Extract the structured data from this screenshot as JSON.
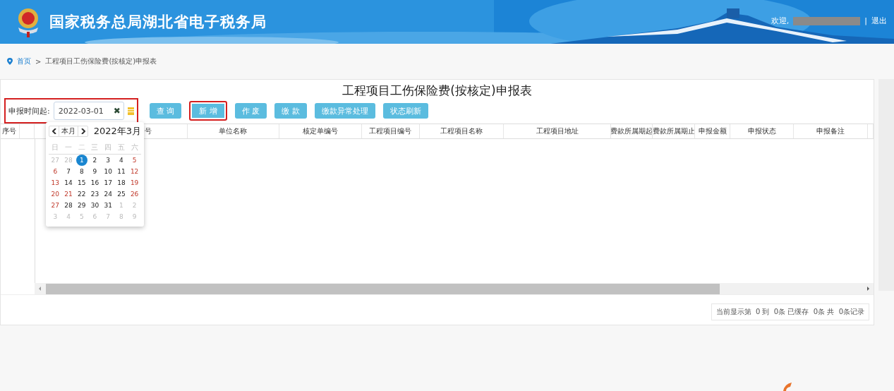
{
  "header": {
    "title": "国家税务总局湖北省电子税务局",
    "welcome": "欢迎,",
    "separator": "|",
    "logout": "退出"
  },
  "breadcrumb": {
    "home": "首页",
    "separator": ">",
    "current": "工程项目工伤保险费(按核定)申报表"
  },
  "page_title": "工程项目工伤保险费(按核定)申报表",
  "filter": {
    "label": "申报时间起:",
    "value": "2022-03-01",
    "clear": "✖",
    "highlighted": true
  },
  "buttons": [
    {
      "label": "查 询",
      "highlighted": false
    },
    {
      "label": "新 增",
      "highlighted": true
    },
    {
      "label": "作 废",
      "highlighted": false
    },
    {
      "label": "缴 款",
      "highlighted": false
    },
    {
      "label": "缴款异常处理",
      "highlighted": false
    },
    {
      "label": "状态刷新",
      "highlighted": false
    }
  ],
  "date_picker": {
    "today": "本月",
    "title": "2022年3月",
    "weekdays": [
      "日",
      "一",
      "二",
      "三",
      "四",
      "五",
      "六"
    ],
    "days": [
      {
        "d": "27",
        "kind": "other",
        "selected": false
      },
      {
        "d": "28",
        "kind": "other",
        "selected": false
      },
      {
        "d": "1",
        "kind": "normal",
        "selected": true
      },
      {
        "d": "2",
        "kind": "normal",
        "selected": false
      },
      {
        "d": "3",
        "kind": "normal",
        "selected": false
      },
      {
        "d": "4",
        "kind": "normal",
        "selected": false
      },
      {
        "d": "5",
        "kind": "red",
        "selected": false
      },
      {
        "d": "6",
        "kind": "red",
        "selected": false
      },
      {
        "d": "7",
        "kind": "normal",
        "selected": false
      },
      {
        "d": "8",
        "kind": "normal",
        "selected": false
      },
      {
        "d": "9",
        "kind": "normal",
        "selected": false
      },
      {
        "d": "10",
        "kind": "normal",
        "selected": false
      },
      {
        "d": "11",
        "kind": "normal",
        "selected": false
      },
      {
        "d": "12",
        "kind": "red",
        "selected": false
      },
      {
        "d": "13",
        "kind": "red",
        "selected": false
      },
      {
        "d": "14",
        "kind": "normal",
        "selected": false
      },
      {
        "d": "15",
        "kind": "normal",
        "selected": false
      },
      {
        "d": "16",
        "kind": "normal",
        "selected": false
      },
      {
        "d": "17",
        "kind": "normal",
        "selected": false
      },
      {
        "d": "18",
        "kind": "normal",
        "selected": false
      },
      {
        "d": "19",
        "kind": "red",
        "selected": false
      },
      {
        "d": "20",
        "kind": "red",
        "selected": false
      },
      {
        "d": "21",
        "kind": "red",
        "selected": false
      },
      {
        "d": "22",
        "kind": "normal",
        "selected": false
      },
      {
        "d": "23",
        "kind": "normal",
        "selected": false
      },
      {
        "d": "24",
        "kind": "normal",
        "selected": false
      },
      {
        "d": "25",
        "kind": "normal",
        "selected": false
      },
      {
        "d": "26",
        "kind": "red",
        "selected": false
      },
      {
        "d": "27",
        "kind": "red",
        "selected": false
      },
      {
        "d": "28",
        "kind": "normal",
        "selected": false
      },
      {
        "d": "29",
        "kind": "normal",
        "selected": false
      },
      {
        "d": "30",
        "kind": "normal",
        "selected": false
      },
      {
        "d": "31",
        "kind": "normal",
        "selected": false
      },
      {
        "d": "1",
        "kind": "other",
        "selected": false
      },
      {
        "d": "2",
        "kind": "other",
        "selected": false
      },
      {
        "d": "3",
        "kind": "other",
        "selected": false
      },
      {
        "d": "4",
        "kind": "other",
        "selected": false
      },
      {
        "d": "5",
        "kind": "other",
        "selected": false
      },
      {
        "d": "6",
        "kind": "other",
        "selected": false
      },
      {
        "d": "7",
        "kind": "other",
        "selected": false
      },
      {
        "d": "8",
        "kind": "other",
        "selected": false
      },
      {
        "d": "9",
        "kind": "other",
        "selected": false
      }
    ]
  },
  "table": {
    "columns": [
      {
        "label": "序号"
      },
      {},
      {
        "label": "号"
      },
      {
        "label": "单位名称"
      },
      {
        "label": "核定单编号"
      },
      {
        "label": "工程项目编号"
      },
      {
        "label": "工程项目名称"
      },
      {
        "label": "工程项目地址"
      },
      {
        "label": "费款所属期起"
      },
      {
        "label": "费款所属期止"
      },
      {
        "label": "申报金额"
      },
      {
        "label": "申报状态"
      },
      {
        "label": "申报备注"
      },
      {}
    ]
  },
  "pagination": {
    "text": "当前显示第  0 到  0条 已缓存  0条 共  0条记录"
  }
}
